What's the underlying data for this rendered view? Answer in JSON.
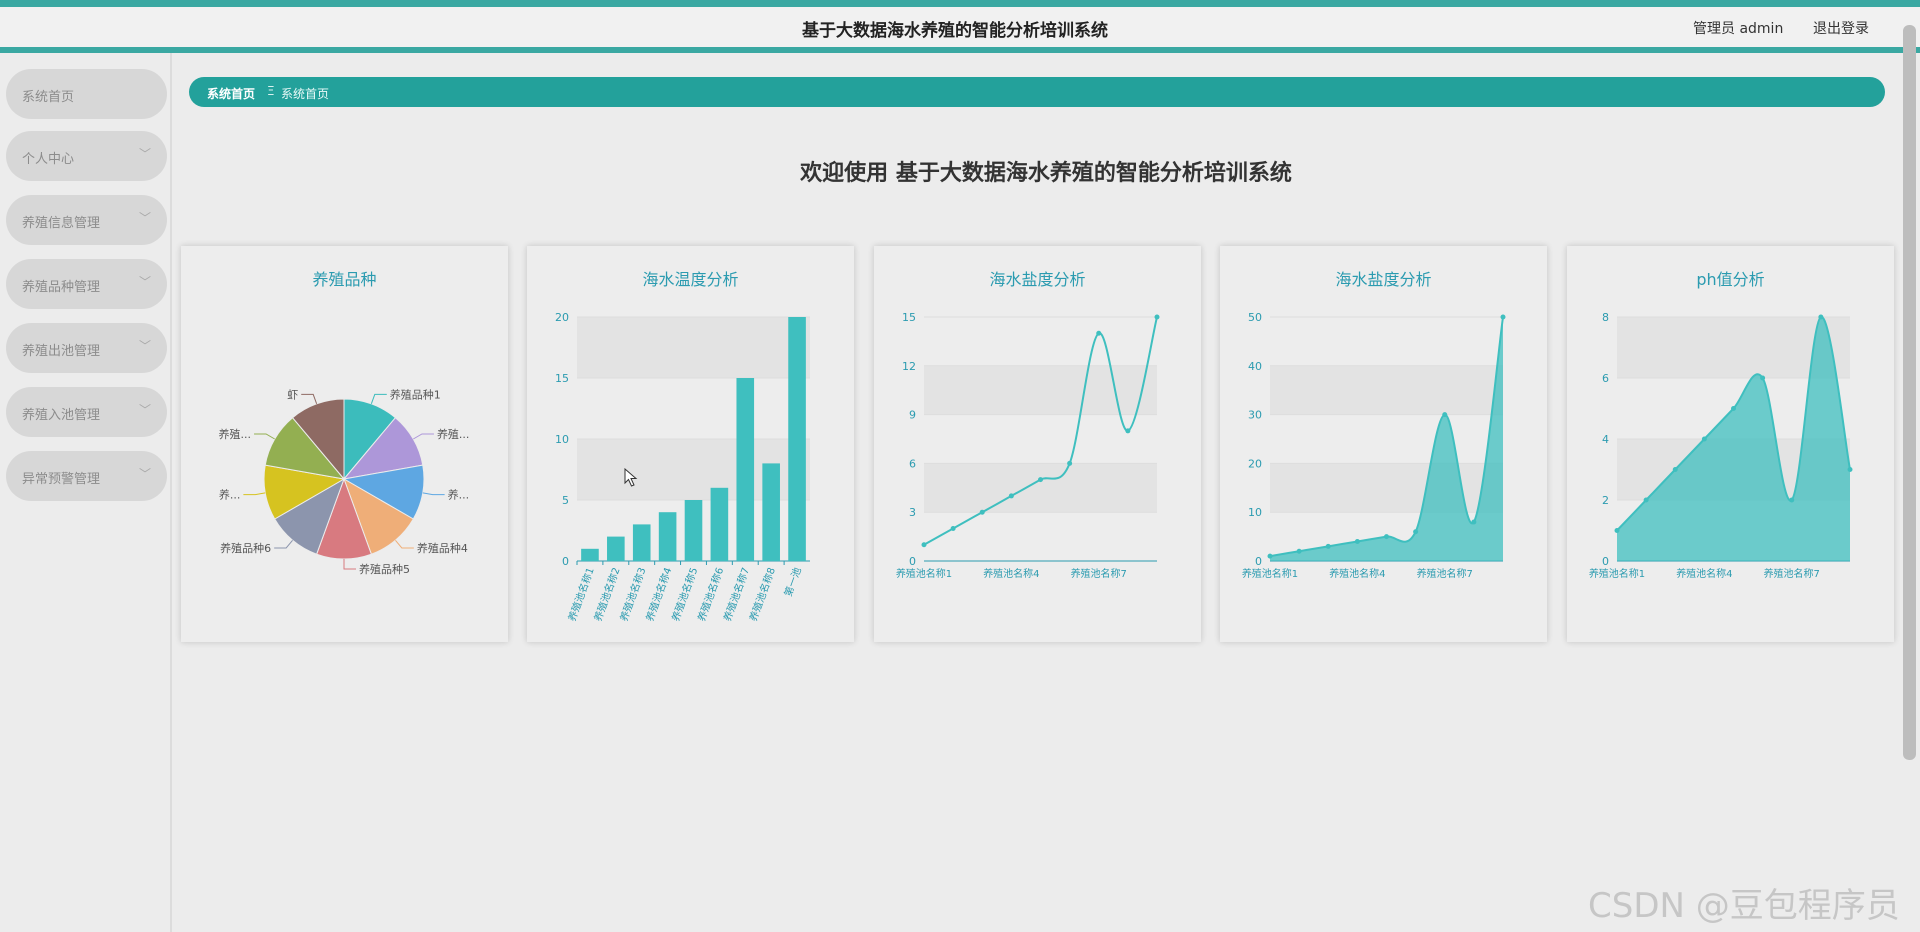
{
  "header": {
    "title": "基于大数据海水养殖的智能分析培训系统",
    "user_label": "管理员 admin",
    "logout_label": "退出登录"
  },
  "sidebar": {
    "items": [
      {
        "label": "系统首页",
        "has_children": false
      },
      {
        "label": "个人中心",
        "has_children": true
      },
      {
        "label": "养殖信息管理",
        "has_children": true
      },
      {
        "label": "养殖品种管理",
        "has_children": true
      },
      {
        "label": "养殖出池管理",
        "has_children": true
      },
      {
        "label": "养殖入池管理",
        "has_children": true
      },
      {
        "label": "异常预警管理",
        "has_children": true
      }
    ]
  },
  "breadcrumb": {
    "home": "系统首页",
    "separator": "Ξ",
    "current": "系统首页"
  },
  "welcome": "欢迎使用 基于大数据海水养殖的智能分析培训系统",
  "colors": {
    "accent": "#23a19b",
    "chart": "#3fbfbf"
  },
  "watermark": "CSDN @豆包程序员",
  "chart_data": [
    {
      "type": "pie",
      "title": "养殖品种",
      "labels": [
        "养殖品种1",
        "养殖...",
        "养...",
        "养殖品种4",
        "养殖品种5",
        "养殖品种6",
        "养...",
        "养殖...",
        "虾"
      ],
      "values": [
        1,
        1,
        1,
        1,
        1,
        1,
        1,
        1,
        1
      ],
      "colors": [
        "#3cbcbc",
        "#ad97d9",
        "#5ea7e2",
        "#efae78",
        "#d87a80",
        "#8c95ad",
        "#d6c320",
        "#93af51",
        "#8e6a63"
      ]
    },
    {
      "type": "bar",
      "title": "海水温度分析",
      "categories": [
        "养殖池名称1",
        "养殖池名称2",
        "养殖池名称3",
        "养殖池名称4",
        "养殖池名称5",
        "养殖池名称6",
        "养殖池名称7",
        "养殖池名称8",
        "第一池"
      ],
      "values": [
        1,
        2,
        3,
        4,
        5,
        6,
        15,
        8,
        20
      ],
      "ylim": [
        0,
        20
      ],
      "yticks": [
        0,
        5,
        10,
        15,
        20
      ]
    },
    {
      "type": "line",
      "title": "海水盐度分析",
      "categories": [
        "养殖池名称1",
        "",
        "",
        "养殖池名称4",
        "",
        "",
        "养殖池名称7",
        "",
        ""
      ],
      "values": [
        1,
        2,
        3,
        4,
        5,
        6,
        14,
        8,
        15
      ],
      "ylim": [
        0,
        15
      ],
      "yticks": [
        0,
        3,
        6,
        9,
        12,
        15
      ]
    },
    {
      "type": "area",
      "title": "海水盐度分析",
      "categories": [
        "养殖池名称1",
        "",
        "",
        "养殖池名称4",
        "",
        "",
        "养殖池名称7",
        "",
        ""
      ],
      "values": [
        1,
        2,
        3,
        4,
        5,
        6,
        30,
        8,
        50
      ],
      "ylim": [
        0,
        50
      ],
      "yticks": [
        0,
        10,
        20,
        30,
        40,
        50
      ]
    },
    {
      "type": "area",
      "title": "ph值分析",
      "categories": [
        "养殖池名称1",
        "",
        "",
        "养殖池名称4",
        "",
        "",
        "养殖池名称7",
        "",
        ""
      ],
      "values": [
        1,
        2,
        3,
        4,
        5,
        6,
        2,
        8,
        3
      ],
      "ylim": [
        0,
        8
      ],
      "yticks": [
        0,
        2,
        4,
        6,
        8
      ]
    }
  ]
}
